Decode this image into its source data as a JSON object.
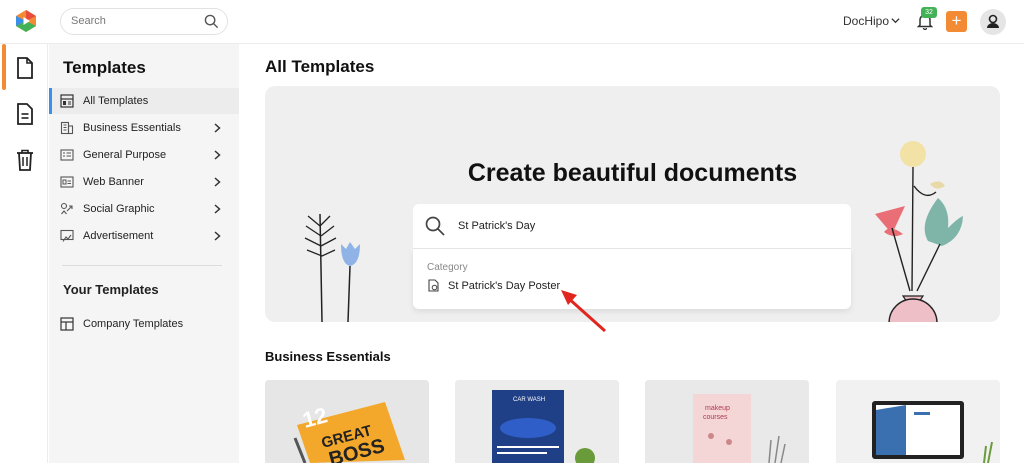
{
  "topbar": {
    "search_placeholder": "Search",
    "account_name": "DocHipo",
    "notification_count": "32",
    "plus_label": "+"
  },
  "sidebar": {
    "title": "Templates",
    "items": [
      {
        "label": "All Templates",
        "icon": "layout-icon",
        "active": true
      },
      {
        "label": "Business Essentials",
        "icon": "building-icon",
        "chevron": true
      },
      {
        "label": "General Purpose",
        "icon": "list-icon",
        "chevron": true
      },
      {
        "label": "Web Banner",
        "icon": "banner-icon",
        "chevron": true
      },
      {
        "label": "Social Graphic",
        "icon": "social-icon",
        "chevron": true
      },
      {
        "label": "Advertisement",
        "icon": "megaphone-icon",
        "chevron": true
      }
    ],
    "your_templates_title": "Your Templates",
    "your_items": [
      {
        "label": "Company Templates",
        "icon": "company-template-icon"
      }
    ]
  },
  "main": {
    "title": "All Templates",
    "hero_title": "Create beautiful documents",
    "hero_search_value": "St Patrick's Day",
    "dropdown_heading": "Category",
    "dropdown_item": "St Patrick's Day Poster",
    "section_title": "Business Essentials"
  },
  "colors": {
    "accent": "#f28b34",
    "active_indicator": "#3a8fe8",
    "badge": "#43b155",
    "arrow": "#e0261f"
  }
}
